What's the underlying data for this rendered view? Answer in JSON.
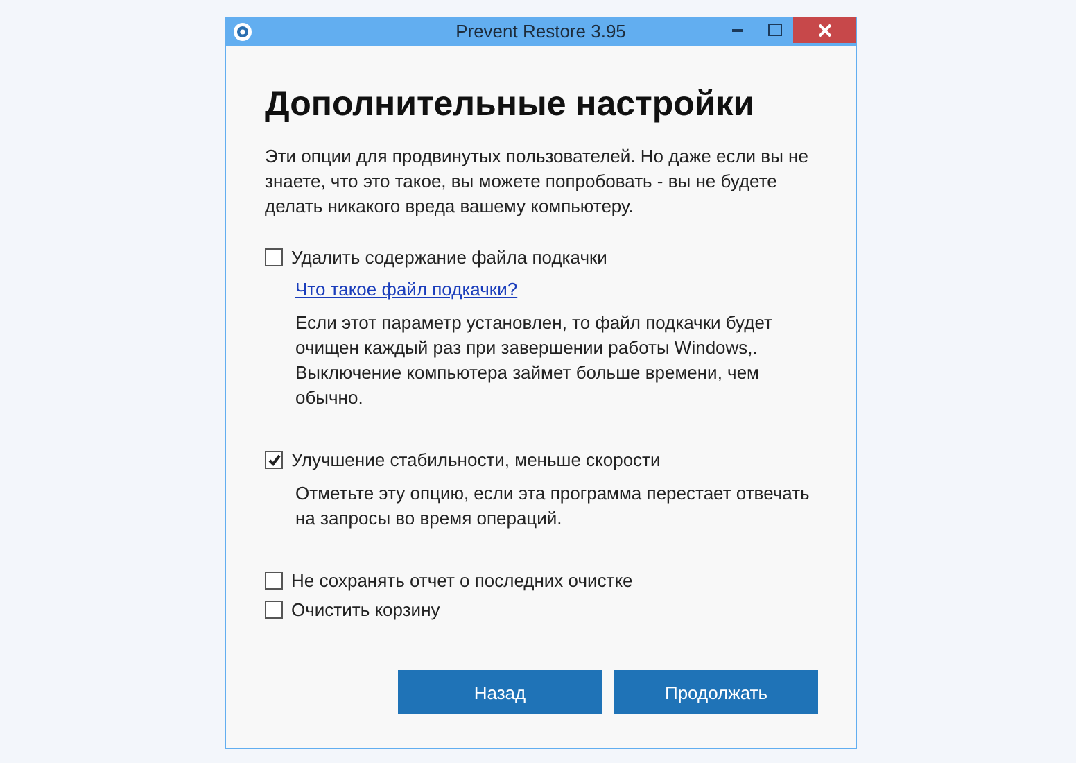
{
  "window": {
    "title": "Prevent Restore 3.95"
  },
  "heading": "Дополнительные настройки",
  "intro": "Эти опции для продвинутых пользователей. Но даже если вы не знаете, что это такое, вы можете попробовать - вы не будете делать никакого вреда вашему компьютеру.",
  "options": [
    {
      "label": "Удалить содержание файла подкачки",
      "checked": false,
      "link": "Что такое файл подкачки?",
      "description": "Если этот параметр установлен, то файл подкачки будет очищен каждый раз при завершении работы Windows,. Выключение компьютера займет больше времени, чем обычно."
    },
    {
      "label": "Улучшение стабильности, меньше скорости",
      "checked": true,
      "description": "Отметьте эту опцию, если эта программа перестает отвечать на запросы во время операций."
    },
    {
      "label": "Не сохранять отчет о последних очистке",
      "checked": false
    },
    {
      "label": "Очистить корзину",
      "checked": false
    }
  ],
  "buttons": [
    "Назад",
    "Продолжать"
  ]
}
